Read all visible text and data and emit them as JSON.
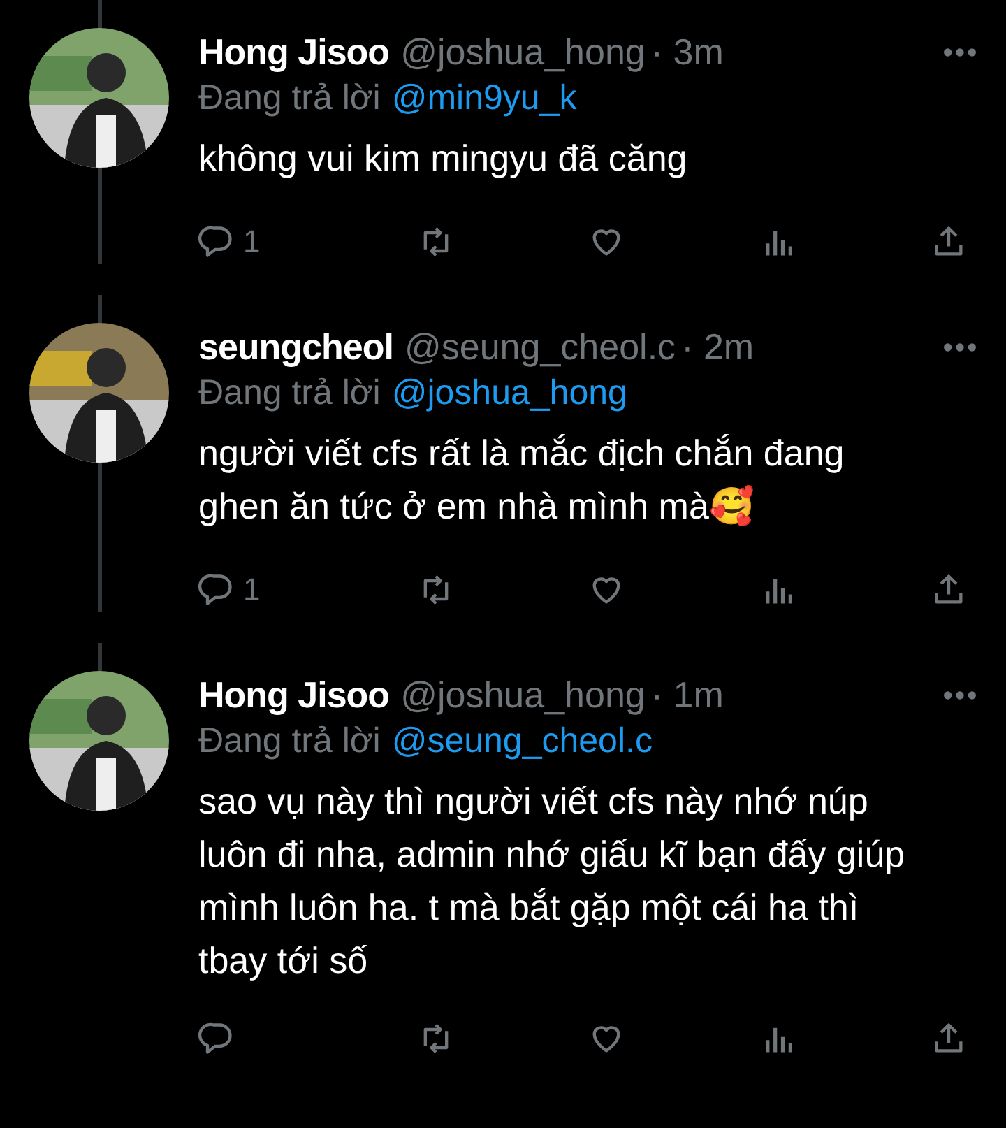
{
  "tweets": [
    {
      "name": "Hong Jisoo",
      "handle": "@joshua_hong",
      "time": "· 3m",
      "replying_label": "Đang trả lời",
      "reply_to": "@min9yu_k",
      "text": "không vui kim mingyu đã căng",
      "reply_count": "1",
      "thread_line_below": true
    },
    {
      "name": "seungcheol",
      "handle": "@seung_cheol.c",
      "time": "· 2m",
      "replying_label": "Đang trả lời",
      "reply_to": "@joshua_hong",
      "text": "người viết cfs rất là mắc địch chắn đang ghen ăn tức ở em nhà mình mà🥰",
      "reply_count": "1",
      "thread_line_below": true
    },
    {
      "name": "Hong Jisoo",
      "handle": "@joshua_hong",
      "time": "· 1m",
      "replying_label": "Đang trả lời",
      "reply_to": "@seung_cheol.c",
      "text": "sao vụ này thì người viết cfs này nhớ núp luôn đi nha, admin nhớ giấu kĩ bạn đấy giúp mình luôn ha. t mà bắt gặp một cái ha thì tbay tới số",
      "thread_line_below": false
    }
  ]
}
